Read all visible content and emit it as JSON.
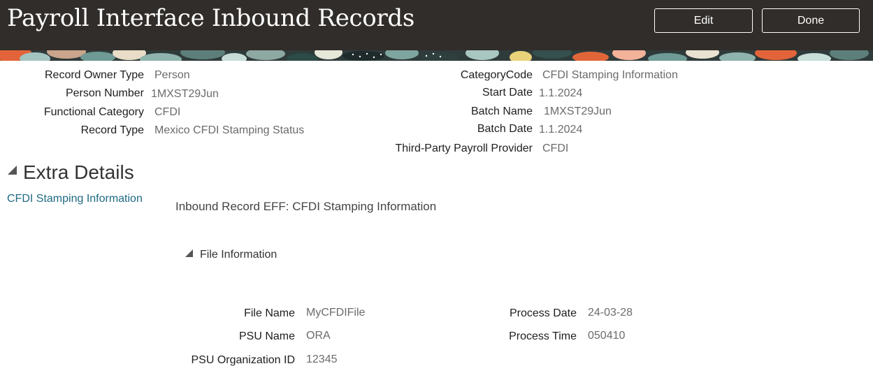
{
  "header": {
    "title": "Payroll Interface Inbound Records",
    "edit_label": "Edit",
    "done_label": "Done"
  },
  "record": {
    "left": [
      {
        "label": "Record Owner Type",
        "value": "Person"
      },
      {
        "label": "Person Number",
        "value": "1MXST29Jun"
      },
      {
        "label": "Functional Category",
        "value": "CFDI"
      },
      {
        "label": "Record Type",
        "value": "Mexico CFDI Stamping Status"
      }
    ],
    "right": [
      {
        "label": "CategoryCode",
        "value": "CFDI Stamping Information"
      },
      {
        "label": "Start Date",
        "value": "1.1.2024"
      },
      {
        "label": "Batch Name",
        "value": "1MXST29Jun"
      },
      {
        "label": "Batch Date",
        "value": "1.1.2024"
      },
      {
        "label": "Third-Party Payroll Provider",
        "value": "CFDI"
      }
    ]
  },
  "extra_details": {
    "title": "Extra Details",
    "link": "CFDI Stamping Information",
    "eff_title": "Inbound Record EFF: CFDI Stamping Information",
    "file_info": {
      "title": "File Information",
      "left": [
        {
          "label": "File Name",
          "value": "MyCFDIFile"
        },
        {
          "label": "PSU Name",
          "value": "ORA"
        },
        {
          "label": "PSU Organization ID",
          "value": "12345"
        }
      ],
      "right": [
        {
          "label": "Process Date",
          "value": "24-03-28"
        },
        {
          "label": "Process Time",
          "value": "050410"
        }
      ]
    }
  },
  "colors": {
    "header_bg": "#312d2a",
    "link": "#1f6a83",
    "label": "#1e1e1e",
    "value": "#6b6b6b"
  }
}
